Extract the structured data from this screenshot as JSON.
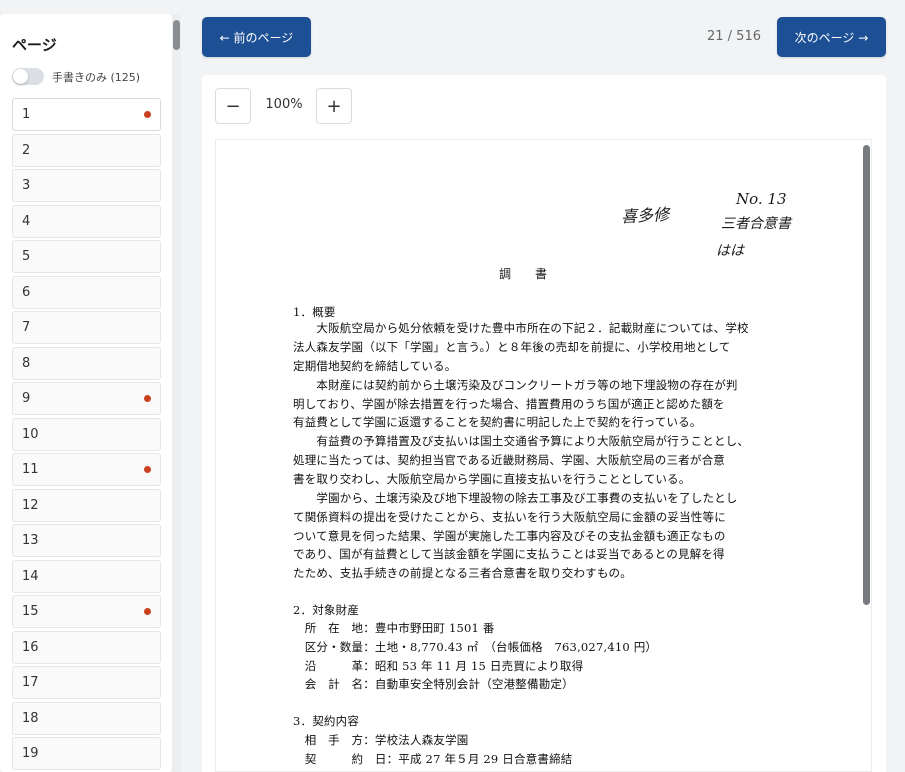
{
  "sidebar": {
    "title": "ページ",
    "toggle_label": "手書きのみ (125)",
    "pages": [
      {
        "label": "1",
        "marked": true
      },
      {
        "label": "2",
        "marked": false
      },
      {
        "label": "3",
        "marked": false
      },
      {
        "label": "4",
        "marked": false
      },
      {
        "label": "5",
        "marked": false
      },
      {
        "label": "6",
        "marked": false
      },
      {
        "label": "7",
        "marked": false
      },
      {
        "label": "8",
        "marked": false
      },
      {
        "label": "9",
        "marked": true
      },
      {
        "label": "10",
        "marked": false
      },
      {
        "label": "11",
        "marked": true
      },
      {
        "label": "12",
        "marked": false
      },
      {
        "label": "13",
        "marked": false
      },
      {
        "label": "14",
        "marked": false
      },
      {
        "label": "15",
        "marked": true
      },
      {
        "label": "16",
        "marked": false
      },
      {
        "label": "17",
        "marked": false
      },
      {
        "label": "18",
        "marked": false
      },
      {
        "label": "19",
        "marked": false
      }
    ]
  },
  "nav": {
    "prev_label": "← 前のページ",
    "next_label": "次のページ →",
    "page_counter": "21 / 516"
  },
  "zoom": {
    "minus": "−",
    "plus": "+",
    "level": "100%"
  },
  "document": {
    "title": "調書",
    "handwriting": {
      "name": "喜多修",
      "number": "No. 13",
      "org": "三者合意書",
      "note": "はは"
    },
    "lines": [
      "1．概要",
      "　　大阪航空局から処分依頼を受けた豊中市所在の下記２．記載財産については、学校",
      "法人森友学園（以下「学園」と言う。）と８年後の売却を前提に、小学校用地として",
      "定期借地契約を締結している。",
      "　　本財産には契約前から土壌汚染及びコンクリートガラ等の地下埋設物の存在が判",
      "明しており、学園が除去措置を行った場合、措置費用のうち国が適正と認めた額を",
      "有益費として学園に返還することを契約書に明記した上で契約を行っている。",
      "　　有益費の予算措置及び支払いは国土交通省予算により大阪航空局が行うこととし、",
      "処理に当たっては、契約担当官である近畿財務局、学園、大阪航空局の三者が合意",
      "書を取り交わし、大阪航空局から学園に直接支払いを行うこととしている。",
      "　　学園から、土壌汚染及び地下埋設物の除去工事及び工事費の支払いを了したとし",
      "て関係資料の提出を受けたことから、支払いを行う大阪航空局に金額の妥当性等に",
      "ついて意見を伺った結果、学園が実施した工事内容及びその支払金額も適正なもの",
      "であり、国が有益費として当該金額を学園に支払うことは妥当であるとの見解を得",
      "たため、支払手続きの前提となる三者合意書を取り交わすもの。",
      "2．対象財産",
      "　所　在　地：豊中市野田町 1501 番",
      "　区分・数量：土地・8,770.43 ㎡　（台帳価格　763,027,410 円）",
      "　沿　　　革：昭和 53 年 11 月 15 日売買により取得",
      "　会　計　名：自動車安全特別会計（空港整備勘定）",
      "3．契約内容",
      "　相　手　方：学校法人森友学園",
      "　契　　　約　日：平成 27 年５月 29 日合意書締結"
    ]
  }
}
